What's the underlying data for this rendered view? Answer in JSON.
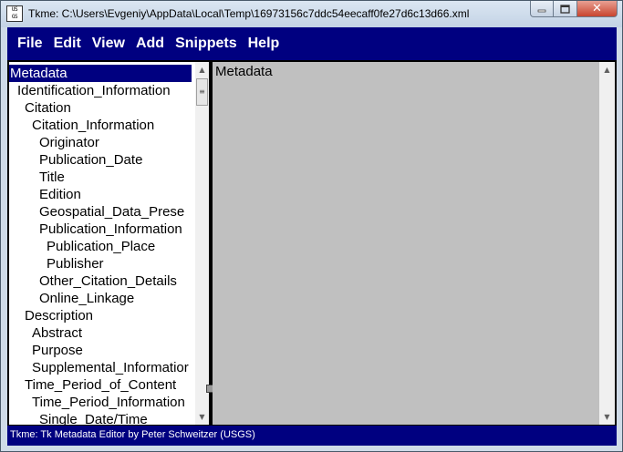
{
  "window": {
    "title": "Tkme: C:\\Users\\Evgeniy\\AppData\\Local\\Temp\\16973156c7ddc54eecaff0fe27d6c13d66.xml",
    "icon_text": [
      "US",
      "GS"
    ],
    "close_glyph": "✕"
  },
  "menu": {
    "file": "File",
    "edit": "Edit",
    "view": "View",
    "add": "Add",
    "snippets": "Snippets",
    "help": "Help"
  },
  "tree": {
    "items": [
      {
        "label": "Metadata",
        "level": 0,
        "selected": true
      },
      {
        "label": "Identification_Information",
        "level": 1
      },
      {
        "label": "Citation",
        "level": 2
      },
      {
        "label": "Citation_Information",
        "level": 3
      },
      {
        "label": "Originator",
        "level": 4
      },
      {
        "label": "Publication_Date",
        "level": 4
      },
      {
        "label": "Title",
        "level": 4
      },
      {
        "label": "Edition",
        "level": 4
      },
      {
        "label": "Geospatial_Data_Prese",
        "level": 4
      },
      {
        "label": "Publication_Information",
        "level": 4
      },
      {
        "label": "Publication_Place",
        "level": 5
      },
      {
        "label": "Publisher",
        "level": 5
      },
      {
        "label": "Other_Citation_Details",
        "level": 4
      },
      {
        "label": "Online_Linkage",
        "level": 4
      },
      {
        "label": "Description",
        "level": 2
      },
      {
        "label": "Abstract",
        "level": 3
      },
      {
        "label": "Purpose",
        "level": 3
      },
      {
        "label": "Supplemental_Informatior",
        "level": 3
      },
      {
        "label": "Time_Period_of_Content",
        "level": 2
      },
      {
        "label": "Time_Period_Information",
        "level": 3
      },
      {
        "label": "Single_Date/Time",
        "level": 4
      }
    ]
  },
  "content": {
    "text": "Metadata"
  },
  "status": {
    "text": "Tkme: Tk Metadata Editor by Peter Schweitzer (USGS)"
  },
  "colors": {
    "menubar": "#000080",
    "selection": "#000080",
    "content_bg": "#c0c0c0"
  }
}
